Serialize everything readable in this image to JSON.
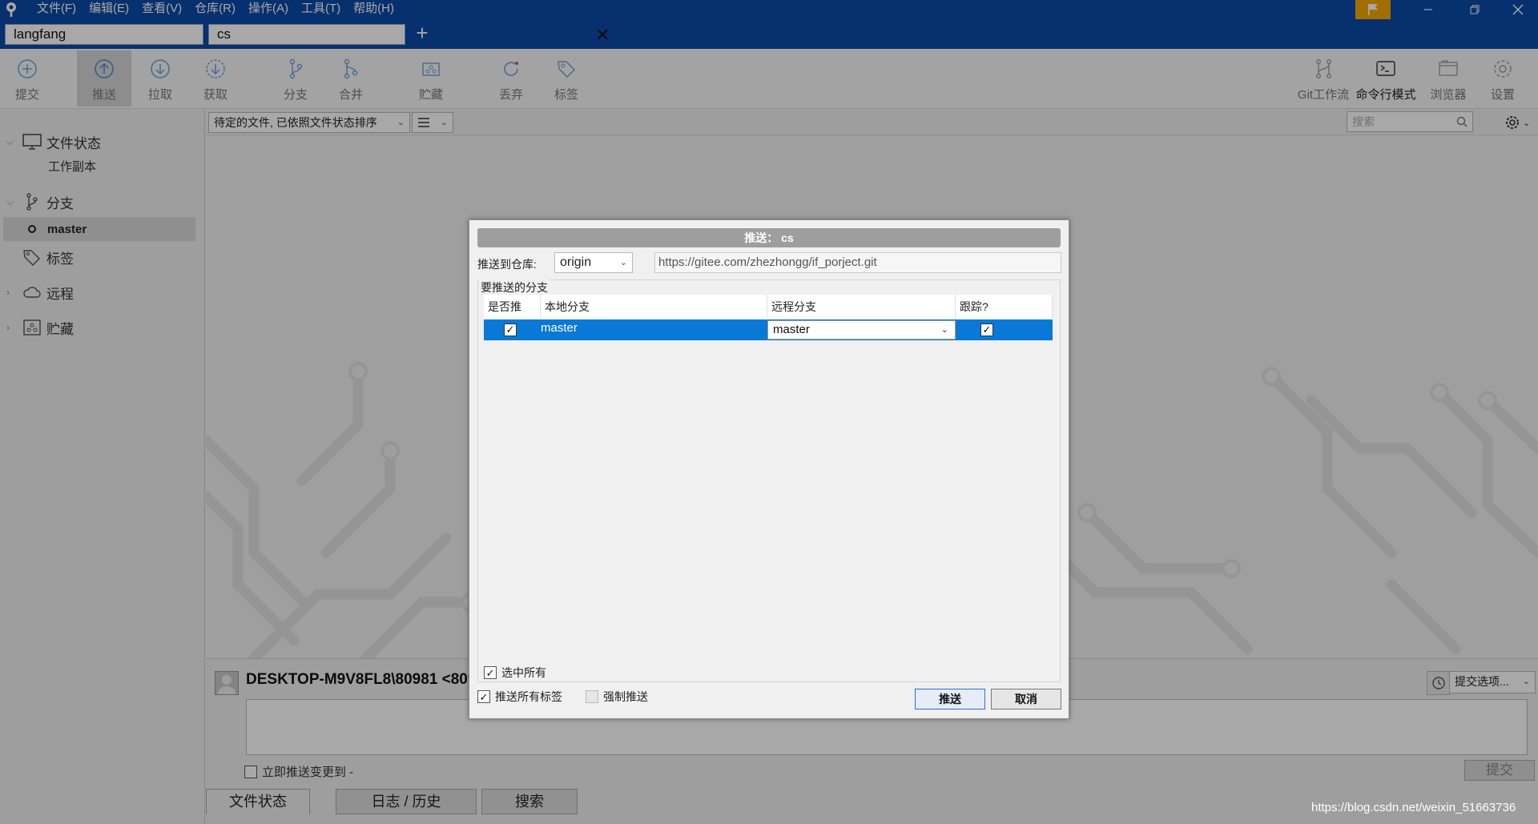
{
  "menu": [
    "文件(F)",
    "编辑(E)",
    "查看(V)",
    "仓库(R)",
    "操作(A)",
    "工具(T)",
    "帮助(H)"
  ],
  "tabs": {
    "first": "langfang",
    "second": "cs"
  },
  "toolbar": {
    "commit": "提交",
    "push": "推送",
    "pull": "拉取",
    "fetch": "获取",
    "branch": "分支",
    "merge": "合并",
    "stash": "贮藏",
    "discard": "丢弃",
    "tag": "标签",
    "git_flow": "Git工作流",
    "terminal": "命令行模式",
    "browser": "浏览器",
    "settings": "设置"
  },
  "sidebar": {
    "file_status": "文件状态",
    "working_copy": "工作副本",
    "branches": "分支",
    "current_branch": "master",
    "tags": "标签",
    "remotes": "远程",
    "stashes": "贮藏"
  },
  "filter": {
    "sort": "待定的文件, 已依照文件状态排序",
    "search_placeholder": "搜索"
  },
  "commit_area": {
    "author": "DESKTOP-M9V8FL8\\80981 <809",
    "push_immediately": "立即推送变更到 -",
    "commit_button": "提交",
    "commit_options": "提交选项..."
  },
  "bottom_tabs": [
    "文件状态",
    "日志 / 历史",
    "搜索"
  ],
  "dialog": {
    "title": "推送： cs",
    "push_to_label": "推送到仓库:",
    "remote": "origin",
    "remote_url": "https://gitee.com/zhezhongg/if_porject.git",
    "branches_label": "要推送的分支",
    "columns": {
      "push": "是否推",
      "local": "本地分支",
      "remote": "远程分支",
      "track": "跟踪?"
    },
    "row": {
      "local": "master",
      "remote": "master",
      "push_checked": "✓",
      "track_checked": "✓"
    },
    "select_all": "选中所有",
    "push_all_tags": "推送所有标签",
    "force_push": "强制推送",
    "push_button": "推送",
    "cancel_button": "取消"
  },
  "watermark": "https://blog.csdn.net/weixin_51663736",
  "colors": {
    "title_bar": "#0b4aa8",
    "selection": "#0a78d7",
    "flag": "#f6a800"
  }
}
